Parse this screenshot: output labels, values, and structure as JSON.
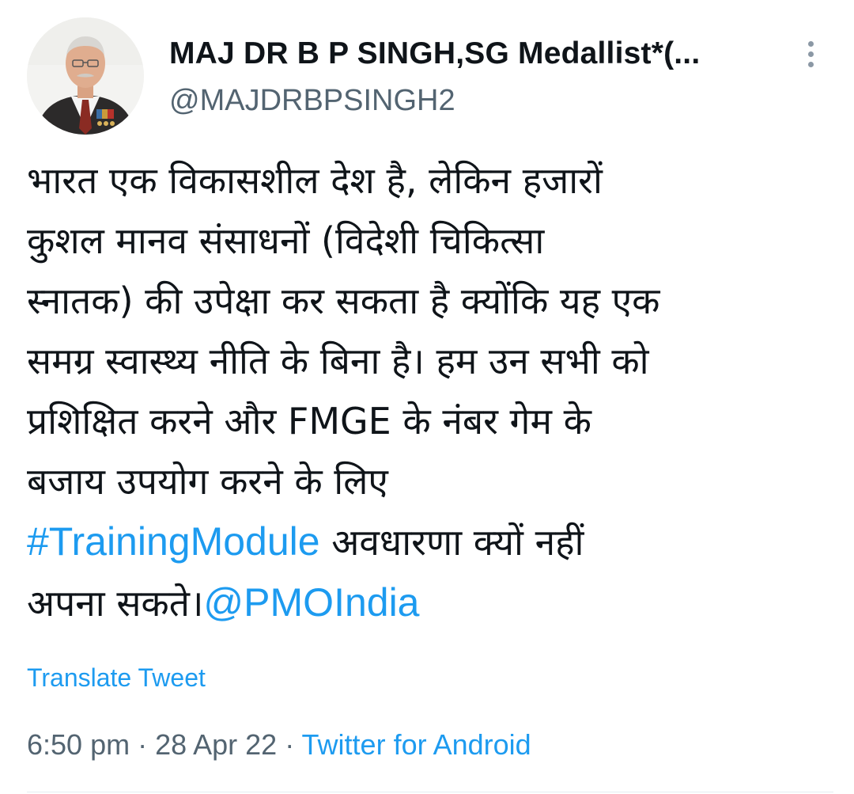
{
  "user": {
    "display_name": "MAJ DR B P SINGH,SG Medallist*(...",
    "handle": "@MAJDRBPSINGH2"
  },
  "tweet": {
    "lines": [
      "भारत एक विकासशील देश है, लेकिन हजारों",
      "कुशल मानव संसाधनों (विदेशी चिकित्सा",
      "स्नातक) की उपेक्षा कर सकता है क्योंकि यह एक",
      "समग्र स्वास्थ्य नीति के बिना है। हम उन सभी को",
      "प्रशिक्षित करने और FMGE के नंबर गेम के",
      "बजाय उपयोग करने के लिए"
    ],
    "hashtag": "#TrainingModule",
    "hashtag_suffix": " अवधारणा क्यों नहीं",
    "last_line_prefix": "अपना सकते।",
    "mention": "@PMOIndia"
  },
  "translate_label": "Translate Tweet",
  "meta": {
    "time": "6:50 pm",
    "separator": " · ",
    "date": "28 Apr 22",
    "source": "Twitter for Android"
  },
  "icons": {
    "more": "more-vertical-icon"
  },
  "colors": {
    "link": "#1d9bf0",
    "secondary_text": "#536471",
    "primary_text": "#0f1419"
  }
}
